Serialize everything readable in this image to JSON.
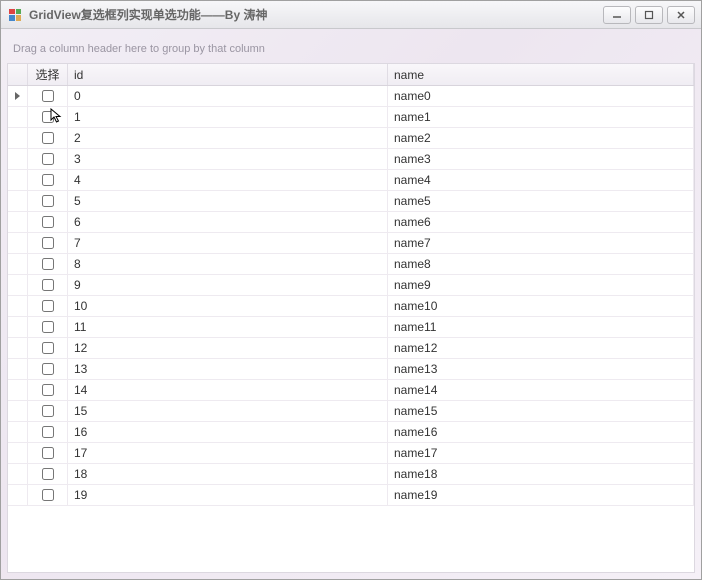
{
  "window": {
    "title": "GridView复选框列实现单选功能——By 涛神"
  },
  "groupPanel": {
    "hint": "Drag a column header here to group by that column"
  },
  "columns": {
    "select": "选择",
    "id": "id",
    "name": "name"
  },
  "rows": [
    {
      "id": "0",
      "name": "name0",
      "indicator": true
    },
    {
      "id": "1",
      "name": "name1"
    },
    {
      "id": "2",
      "name": "name2"
    },
    {
      "id": "3",
      "name": "name3"
    },
    {
      "id": "4",
      "name": "name4"
    },
    {
      "id": "5",
      "name": "name5"
    },
    {
      "id": "6",
      "name": "name6"
    },
    {
      "id": "7",
      "name": "name7"
    },
    {
      "id": "8",
      "name": "name8"
    },
    {
      "id": "9",
      "name": "name9"
    },
    {
      "id": "10",
      "name": "name10"
    },
    {
      "id": "11",
      "name": "name11"
    },
    {
      "id": "12",
      "name": "name12"
    },
    {
      "id": "13",
      "name": "name13"
    },
    {
      "id": "14",
      "name": "name14"
    },
    {
      "id": "15",
      "name": "name15"
    },
    {
      "id": "16",
      "name": "name16"
    },
    {
      "id": "17",
      "name": "name17"
    },
    {
      "id": "18",
      "name": "name18"
    },
    {
      "id": "19",
      "name": "name19"
    }
  ],
  "chart_data": {
    "type": "table",
    "columns": [
      "选择",
      "id",
      "name"
    ],
    "rows": [
      [
        false,
        0,
        "name0"
      ],
      [
        false,
        1,
        "name1"
      ],
      [
        false,
        2,
        "name2"
      ],
      [
        false,
        3,
        "name3"
      ],
      [
        false,
        4,
        "name4"
      ],
      [
        false,
        5,
        "name5"
      ],
      [
        false,
        6,
        "name6"
      ],
      [
        false,
        7,
        "name7"
      ],
      [
        false,
        8,
        "name8"
      ],
      [
        false,
        9,
        "name9"
      ],
      [
        false,
        10,
        "name10"
      ],
      [
        false,
        11,
        "name11"
      ],
      [
        false,
        12,
        "name12"
      ],
      [
        false,
        13,
        "name13"
      ],
      [
        false,
        14,
        "name14"
      ],
      [
        false,
        15,
        "name15"
      ],
      [
        false,
        16,
        "name16"
      ],
      [
        false,
        17,
        "name17"
      ],
      [
        false,
        18,
        "name18"
      ],
      [
        false,
        19,
        "name19"
      ]
    ]
  }
}
